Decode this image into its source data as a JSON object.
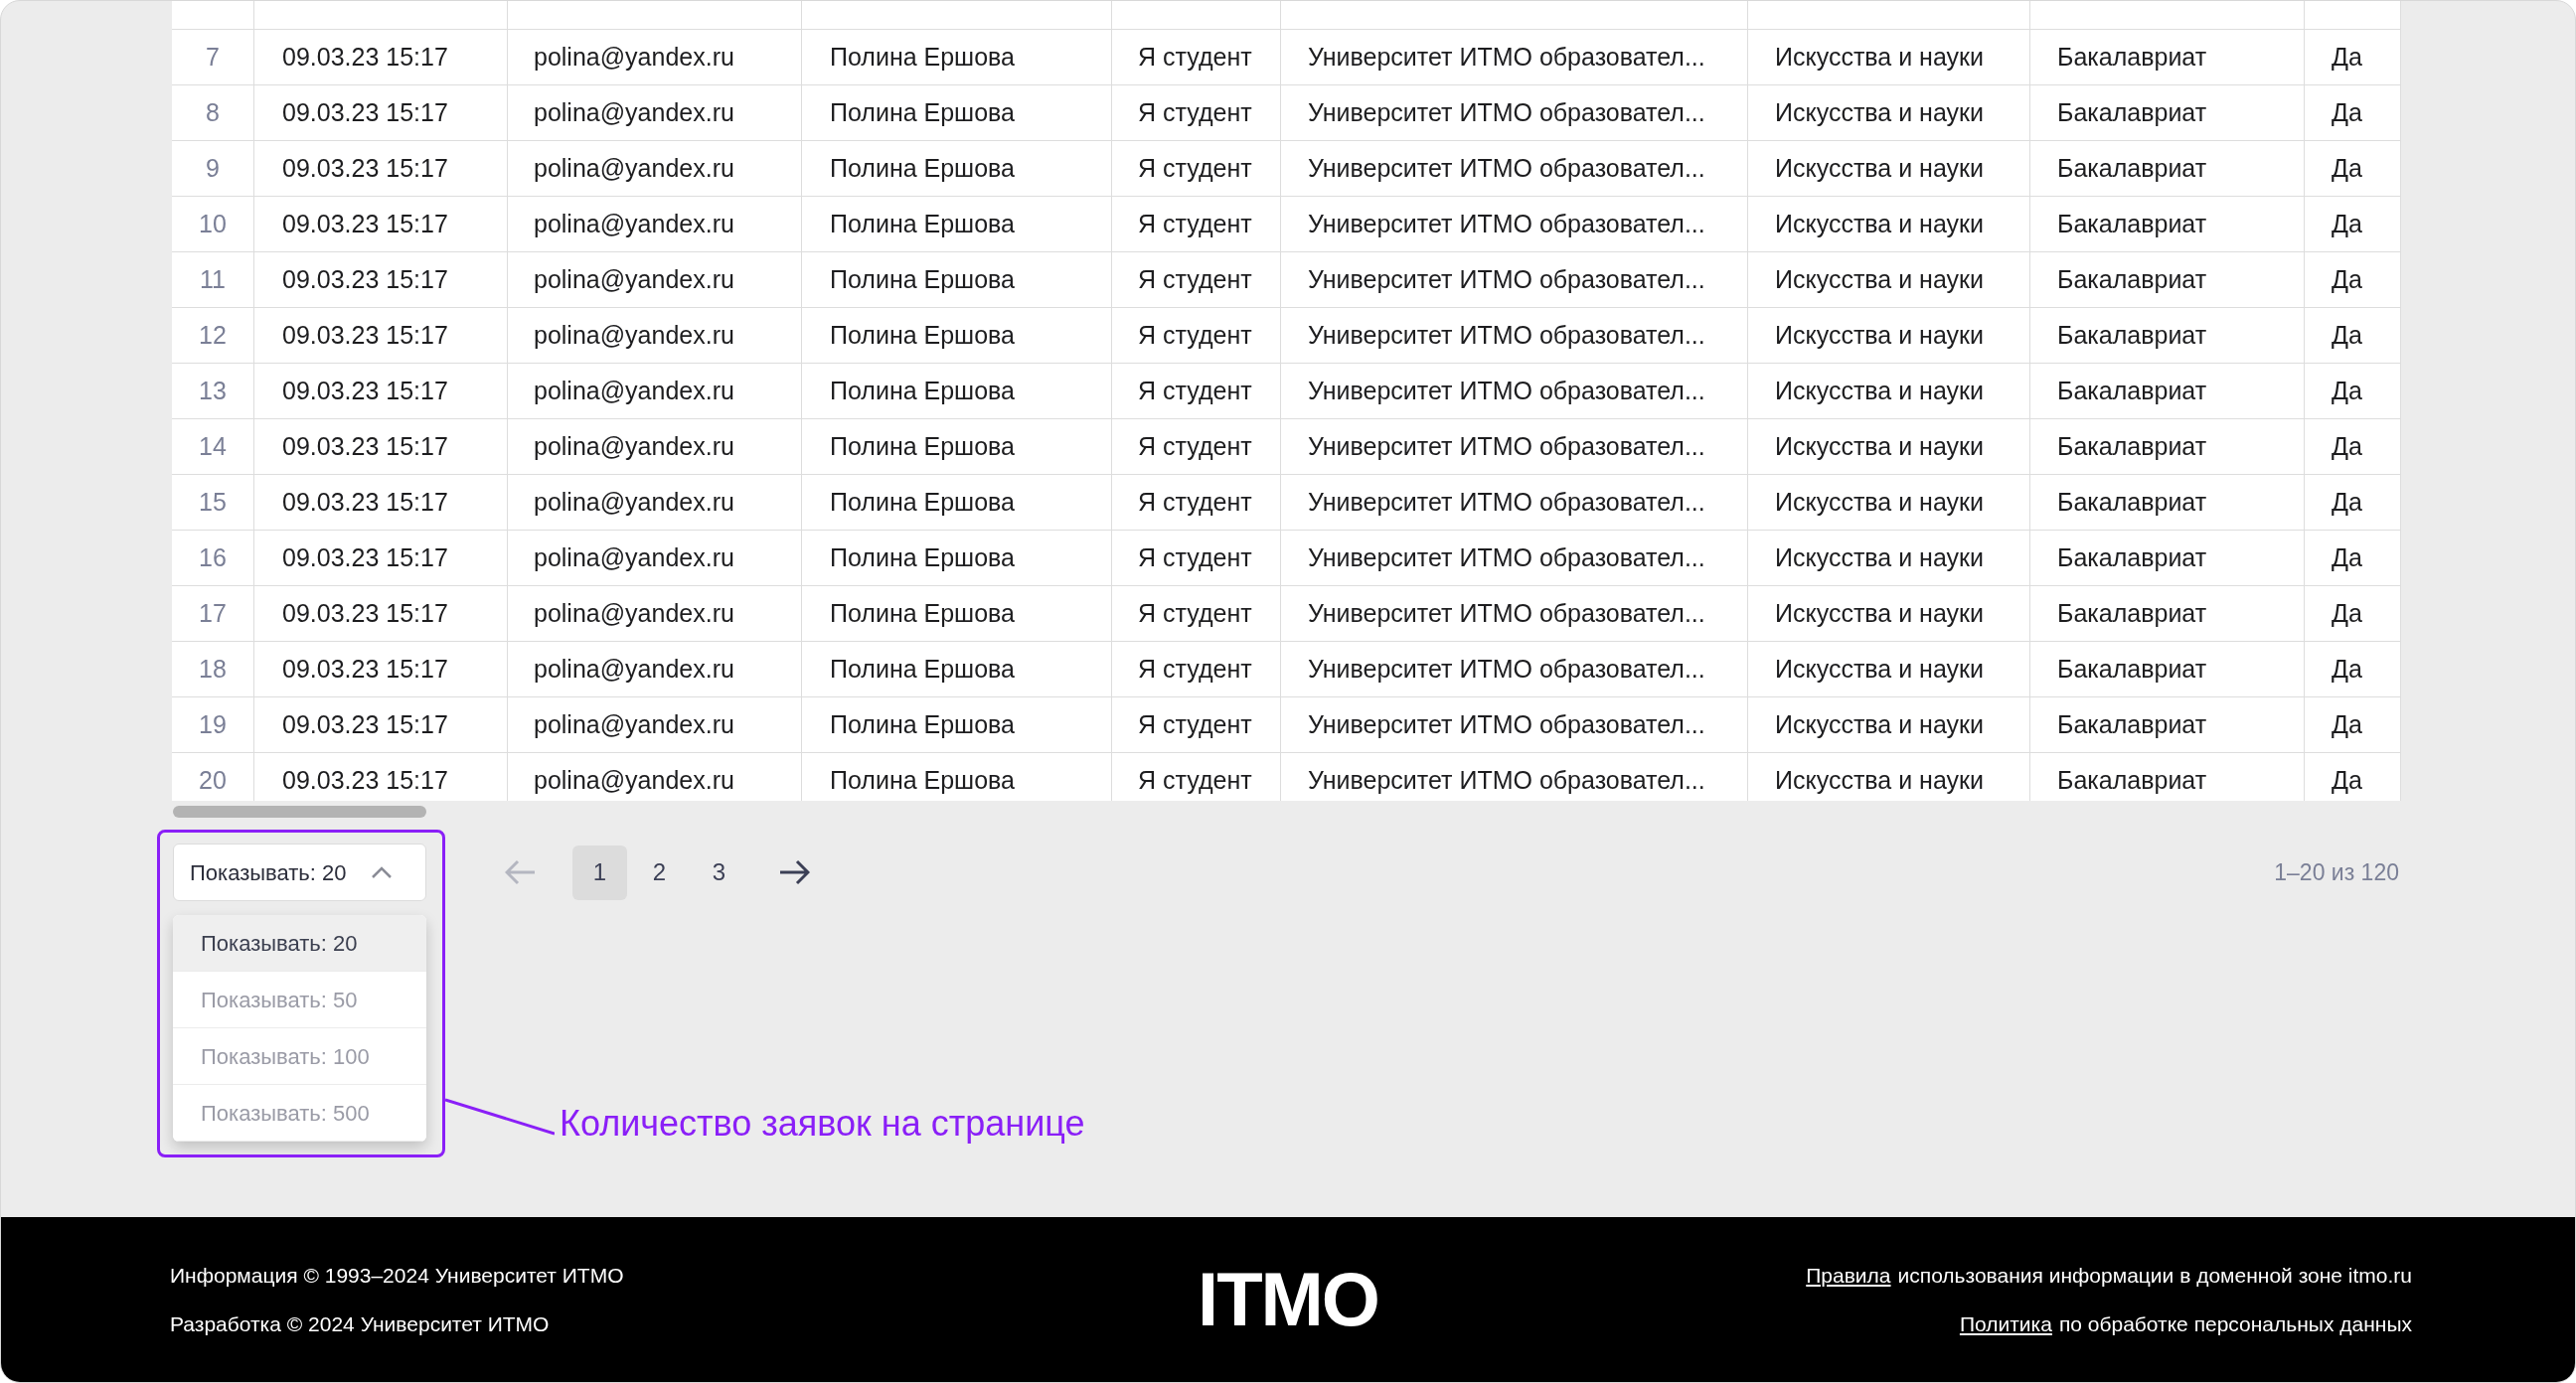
{
  "table": {
    "rows": [
      {
        "number": "7",
        "date": "09.03.23 15:17",
        "email": "polina@yandex.ru",
        "name": "Полина Ершова",
        "status": "Я студент",
        "university": "Университет ИТМО образовател...",
        "field": "Искусства и науки",
        "level": "Бакалавриат",
        "consent": "Да"
      },
      {
        "number": "8",
        "date": "09.03.23 15:17",
        "email": "polina@yandex.ru",
        "name": "Полина Ершова",
        "status": "Я студент",
        "university": "Университет ИТМО образовател...",
        "field": "Искусства и науки",
        "level": "Бакалавриат",
        "consent": "Да"
      },
      {
        "number": "9",
        "date": "09.03.23 15:17",
        "email": "polina@yandex.ru",
        "name": "Полина Ершова",
        "status": "Я студент",
        "university": "Университет ИТМО образовател...",
        "field": "Искусства и науки",
        "level": "Бакалавриат",
        "consent": "Да"
      },
      {
        "number": "10",
        "date": "09.03.23 15:17",
        "email": "polina@yandex.ru",
        "name": "Полина Ершова",
        "status": "Я студент",
        "university": "Университет ИТМО образовател...",
        "field": "Искусства и науки",
        "level": "Бакалавриат",
        "consent": "Да"
      },
      {
        "number": "11",
        "date": "09.03.23 15:17",
        "email": "polina@yandex.ru",
        "name": "Полина Ершова",
        "status": "Я студент",
        "university": "Университет ИТМО образовател...",
        "field": "Искусства и науки",
        "level": "Бакалавриат",
        "consent": "Да"
      },
      {
        "number": "12",
        "date": "09.03.23 15:17",
        "email": "polina@yandex.ru",
        "name": "Полина Ершова",
        "status": "Я студент",
        "university": "Университет ИТМО образовател...",
        "field": "Искусства и науки",
        "level": "Бакалавриат",
        "consent": "Да"
      },
      {
        "number": "13",
        "date": "09.03.23 15:17",
        "email": "polina@yandex.ru",
        "name": "Полина Ершова",
        "status": "Я студент",
        "university": "Университет ИТМО образовател...",
        "field": "Искусства и науки",
        "level": "Бакалавриат",
        "consent": "Да"
      },
      {
        "number": "14",
        "date": "09.03.23 15:17",
        "email": "polina@yandex.ru",
        "name": "Полина Ершова",
        "status": "Я студент",
        "university": "Университет ИТМО образовател...",
        "field": "Искусства и науки",
        "level": "Бакалавриат",
        "consent": "Да"
      },
      {
        "number": "15",
        "date": "09.03.23 15:17",
        "email": "polina@yandex.ru",
        "name": "Полина Ершова",
        "status": "Я студент",
        "university": "Университет ИТМО образовател...",
        "field": "Искусства и науки",
        "level": "Бакалавриат",
        "consent": "Да"
      },
      {
        "number": "16",
        "date": "09.03.23 15:17",
        "email": "polina@yandex.ru",
        "name": "Полина Ершова",
        "status": "Я студент",
        "university": "Университет ИТМО образовател...",
        "field": "Искусства и науки",
        "level": "Бакалавриат",
        "consent": "Да"
      },
      {
        "number": "17",
        "date": "09.03.23 15:17",
        "email": "polina@yandex.ru",
        "name": "Полина Ершова",
        "status": "Я студент",
        "university": "Университет ИТМО образовател...",
        "field": "Искусства и науки",
        "level": "Бакалавриат",
        "consent": "Да"
      },
      {
        "number": "18",
        "date": "09.03.23 15:17",
        "email": "polina@yandex.ru",
        "name": "Полина Ершова",
        "status": "Я студент",
        "university": "Университет ИТМО образовател...",
        "field": "Искусства и науки",
        "level": "Бакалавриат",
        "consent": "Да"
      },
      {
        "number": "19",
        "date": "09.03.23 15:17",
        "email": "polina@yandex.ru",
        "name": "Полина Ершова",
        "status": "Я студент",
        "university": "Университет ИТМО образовател...",
        "field": "Искусства и науки",
        "level": "Бакалавриат",
        "consent": "Да"
      },
      {
        "number": "20",
        "date": "09.03.23 15:17",
        "email": "polina@yandex.ru",
        "name": "Полина Ершова",
        "status": "Я студент",
        "university": "Университет ИТМО образовател...",
        "field": "Искусства и науки",
        "level": "Бакалавриат",
        "consent": "Да"
      }
    ]
  },
  "pagination": {
    "page_size": {
      "value": "Показывать: 20",
      "expanded": true,
      "options": [
        {
          "label": "Показывать: 20",
          "selected": true
        },
        {
          "label": "Показывать: 50",
          "selected": false
        },
        {
          "label": "Показывать: 100",
          "selected": false
        },
        {
          "label": "Показывать: 500",
          "selected": false
        }
      ]
    },
    "prev_disabled": true,
    "pages": [
      {
        "label": "1",
        "selected": true
      },
      {
        "label": "2",
        "selected": false
      },
      {
        "label": "3",
        "selected": false
      }
    ],
    "range": "1–20 из 120"
  },
  "annotation": {
    "text": "Количество заявок на странице"
  },
  "footer": {
    "left": [
      "Информация © 1993–2024 Университет ИТМО",
      "Разработка © 2024 Университет ИТМО"
    ],
    "logo": "ITMO",
    "right": [
      {
        "link": "Правила",
        "text": "использования информации в доменной зоне itmo.ru"
      },
      {
        "link": "Политика",
        "text": "по обработке персональных данных"
      }
    ]
  }
}
